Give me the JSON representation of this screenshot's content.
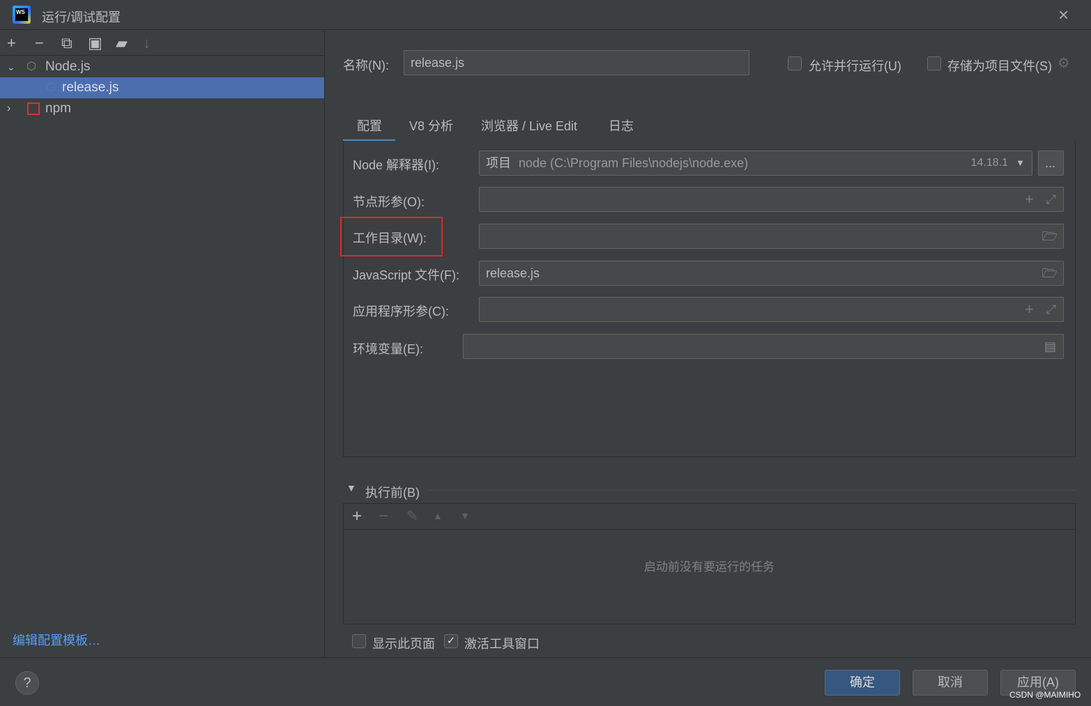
{
  "window": {
    "title": "运行/调试配置",
    "close": "×"
  },
  "tree": {
    "items": [
      {
        "label": "Node.js"
      },
      {
        "label": "release.js"
      },
      {
        "label": "npm"
      }
    ],
    "edit_templates": "编辑配置模板…"
  },
  "form": {
    "name_label": "名称(N):",
    "name_value": "release.js",
    "allow_parallel": "允许并行运行(U)",
    "store_as_file": "存储为项目文件(S)",
    "tabs": [
      "配置",
      "V8 分析",
      "浏览器 / Live Edit",
      "日志"
    ],
    "node_label": "Node 解释器(I):",
    "node_prefix": "项目",
    "node_value": "node (C:\\Program Files\\nodejs\\node.exe)",
    "node_version": "14.18.1",
    "more": "...",
    "node_params_label": "节点形参(O):",
    "workdir_label": "工作目录(W):",
    "jsfile_label": "JavaScript 文件(F):",
    "jsfile_value": "release.js",
    "app_params_label": "应用程序形参(C):",
    "env_label": "环境变量(E):"
  },
  "before": {
    "title": "执行前(B)",
    "empty": "启动前没有要运行的任务"
  },
  "options": {
    "show_page": "显示此页面",
    "show_page_checked": false,
    "activate_tool": "激活工具窗口",
    "activate_tool_checked": true
  },
  "buttons": {
    "ok": "确定",
    "cancel": "取消",
    "apply": "应用(A)",
    "help": "?"
  },
  "watermark": "CSDN @MAIMIHO",
  "colors": {
    "accent": "#4b6eaf",
    "highlight_box": "#e0262a",
    "link": "#589df6"
  }
}
